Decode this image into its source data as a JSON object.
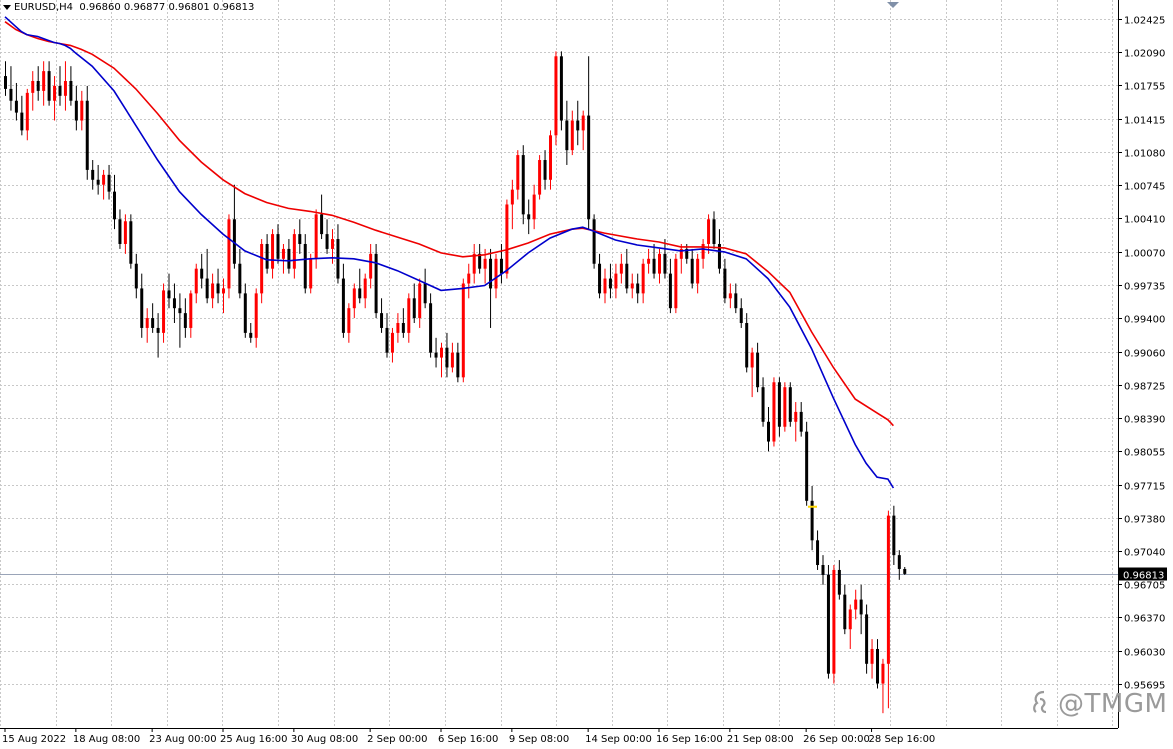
{
  "header": {
    "symbol_tf": "EURUSD,H4",
    "ohlc": "0.96860 0.96877 0.96801 0.96813"
  },
  "watermark": "@TMGM",
  "colors": {
    "bull": "#ff0000",
    "bear": "#000000",
    "ma_fast": "#0000cc",
    "ma_slow": "#ee0000",
    "grid": "#c8c8c8",
    "price_line": "#9aa4b8",
    "marker": "#ffd700"
  },
  "chart_data": {
    "type": "candlestick",
    "symbol": "EURUSD",
    "timeframe": "H4",
    "current_price": 0.96813,
    "current_price_label": "0.96813",
    "ylim": [
      0.9525,
      1.0262
    ],
    "y_ticks": [
      1.02425,
      1.0209,
      1.01755,
      1.01415,
      1.0108,
      1.00745,
      1.0041,
      1.0007,
      0.99735,
      0.994,
      0.9906,
      0.98725,
      0.9839,
      0.98055,
      0.97715,
      0.9738,
      0.9704,
      0.96705,
      0.9637,
      0.9603,
      0.95695
    ],
    "y_tick_labels": [
      "1.02425",
      "1.02090",
      "1.01755",
      "1.01415",
      "1.01080",
      "1.00745",
      "1.00410",
      "1.00070",
      "0.99735",
      "0.99400",
      "0.99060",
      "0.98725",
      "0.98390",
      "0.98055",
      "0.97715",
      "0.97380",
      "0.97040",
      "0.96705",
      "0.96370",
      "0.96030",
      "0.95695"
    ],
    "x_labels": [
      "15 Aug 2022",
      "18 Aug 08:00",
      "23 Aug 00:00",
      "25 Aug 16:00",
      "30 Aug 08:00",
      "2 Sep 00:00",
      "6 Sep 16:00",
      "9 Sep 08:00",
      "14 Sep 00:00",
      "16 Sep 16:00",
      "21 Sep 08:00",
      "26 Sep 00:00",
      "28 Sep 16:00"
    ],
    "marker_price": 0.9749,
    "candles": [
      [
        1.0185,
        1.02,
        1.0165,
        1.0172
      ],
      [
        1.0172,
        1.0195,
        1.015,
        1.016
      ],
      [
        1.016,
        1.0178,
        1.014,
        1.0148
      ],
      [
        1.0148,
        1.0165,
        1.0125,
        1.013
      ],
      [
        1.013,
        1.0172,
        1.012,
        1.0168
      ],
      [
        1.0168,
        1.019,
        1.015,
        1.018
      ],
      [
        1.018,
        1.0195,
        1.016,
        1.017
      ],
      [
        1.017,
        1.02,
        1.0155,
        1.019
      ],
      [
        1.019,
        1.02,
        1.0155,
        1.016
      ],
      [
        1.016,
        1.0185,
        1.014,
        1.0175
      ],
      [
        1.0175,
        1.0195,
        1.0155,
        1.0165
      ],
      [
        1.0165,
        1.02,
        1.015,
        1.018
      ],
      [
        1.018,
        1.0195,
        1.0155,
        1.016
      ],
      [
        1.016,
        1.0175,
        1.013,
        1.014
      ],
      [
        1.014,
        1.017,
        1.013,
        1.016
      ],
      [
        1.016,
        1.0175,
        1.008,
        1.009
      ],
      [
        1.009,
        1.01,
        1.007,
        1.008
      ],
      [
        1.008,
        1.0095,
        1.0065,
        1.0075
      ],
      [
        1.0075,
        1.009,
        1.006,
        1.0085
      ],
      [
        1.0085,
        1.0095,
        1.006,
        1.0068
      ],
      [
        1.0068,
        1.0085,
        1.003,
        1.004
      ],
      [
        1.004,
        1.005,
        1.001,
        1.0015
      ],
      [
        1.0015,
        1.0045,
        1.0005,
        1.0038
      ],
      [
        1.0038,
        1.0045,
        0.999,
        0.9995
      ],
      [
        0.9995,
        1.0005,
        0.996,
        0.997
      ],
      [
        0.997,
        0.9985,
        0.992,
        0.993
      ],
      [
        0.993,
        0.995,
        0.9915,
        0.994
      ],
      [
        0.994,
        0.9955,
        0.9925,
        0.993
      ],
      [
        0.993,
        0.9945,
        0.99,
        0.9925
      ],
      [
        0.9925,
        0.9975,
        0.9915,
        0.9968
      ],
      [
        0.9968,
        0.9985,
        0.995,
        0.996
      ],
      [
        0.996,
        0.9975,
        0.9935,
        0.995
      ],
      [
        0.995,
        0.9965,
        0.991,
        0.9945
      ],
      [
        0.9945,
        0.996,
        0.992,
        0.993
      ],
      [
        0.993,
        0.9968,
        0.992,
        0.9965
      ],
      [
        0.9965,
        0.9995,
        0.9955,
        0.999
      ],
      [
        0.999,
        1.0005,
        0.997,
        0.998
      ],
      [
        0.998,
        1.001,
        0.9955,
        0.996
      ],
      [
        0.996,
        0.9985,
        0.995,
        0.9975
      ],
      [
        0.9975,
        0.999,
        0.9955,
        0.9965
      ],
      [
        0.9965,
        0.998,
        0.9945,
        0.997
      ],
      [
        0.997,
        1.0045,
        0.996,
        1.004
      ],
      [
        1.004,
        1.0075,
        0.999,
        0.9995
      ],
      [
        0.9995,
        1.001,
        0.996,
        0.9965
      ],
      [
        0.9965,
        0.9975,
        0.992,
        0.9925
      ],
      [
        0.9925,
        0.9935,
        0.9915,
        0.992
      ],
      [
        0.992,
        0.997,
        0.991,
        0.9965
      ],
      [
        0.9965,
        1.002,
        0.9955,
        1.0015
      ],
      [
        1.0015,
        1.0025,
        0.9985,
        0.999
      ],
      [
        0.999,
        1.003,
        0.998,
        1.0025
      ],
      [
        1.0025,
        1.0035,
        0.9995,
        1.0
      ],
      [
        1.0,
        1.0015,
        0.9985,
        1.001
      ],
      [
        1.001,
        1.002,
        0.9985,
        0.999
      ],
      [
        0.999,
        1.003,
        0.998,
        1.0025
      ],
      [
        1.0025,
        1.004,
        1.0005,
        1.0015
      ],
      [
        1.0015,
        1.0025,
        0.9965,
        0.997
      ],
      [
        0.997,
        1.0005,
        0.9965,
        1.0
      ],
      [
        1.0,
        1.005,
        0.999,
        1.0045
      ],
      [
        1.0045,
        1.0065,
        1.002,
        1.0025
      ],
      [
        1.0025,
        1.004,
        1.0005,
        1.001
      ],
      [
        1.001,
        1.003,
        0.9995,
        1.002
      ],
      [
        1.002,
        1.0035,
        0.9975,
        0.998
      ],
      [
        0.998,
        0.9995,
        0.992,
        0.9925
      ],
      [
        0.9925,
        0.9955,
        0.9915,
        0.995
      ],
      [
        0.995,
        0.9975,
        0.994,
        0.997
      ],
      [
        0.997,
        0.999,
        0.9955,
        0.996
      ],
      [
        0.996,
        0.9985,
        0.995,
        0.998
      ],
      [
        0.998,
        1.0015,
        0.997,
        1.0005
      ],
      [
        1.0005,
        1.0015,
        0.994,
        0.9945
      ],
      [
        0.9945,
        0.996,
        0.9925,
        0.993
      ],
      [
        0.993,
        0.9945,
        0.99,
        0.9905
      ],
      [
        0.9905,
        0.993,
        0.9895,
        0.9925
      ],
      [
        0.9925,
        0.9945,
        0.9915,
        0.9935
      ],
      [
        0.9935,
        0.995,
        0.992,
        0.9925
      ],
      [
        0.9925,
        0.9965,
        0.9915,
        0.996
      ],
      [
        0.996,
        0.9975,
        0.9935,
        0.994
      ],
      [
        0.994,
        0.998,
        0.993,
        0.9975
      ],
      [
        0.9975,
        0.999,
        0.995,
        0.9955
      ],
      [
        0.9955,
        0.9965,
        0.99,
        0.9905
      ],
      [
        0.9905,
        0.992,
        0.989,
        0.99
      ],
      [
        0.99,
        0.9915,
        0.988,
        0.991
      ],
      [
        0.991,
        0.9925,
        0.988,
        0.989
      ],
      [
        0.989,
        0.9915,
        0.9885,
        0.9905
      ],
      [
        0.9905,
        0.9915,
        0.9875,
        0.988
      ],
      [
        0.988,
        0.998,
        0.9875,
        0.9975
      ],
      [
        0.9975,
        0.9995,
        0.996,
        0.9985
      ],
      [
        0.9985,
        1.0015,
        0.9975,
        1.0005
      ],
      [
        1.0005,
        1.0015,
        0.9985,
        0.999
      ],
      [
        0.999,
        1.001,
        0.9975,
        1.0
      ],
      [
        1.0,
        1.001,
        0.993,
        0.997
      ],
      [
        0.997,
        1.0005,
        0.996,
        1.0
      ],
      [
        1.0,
        1.0015,
        0.9975,
        0.9985
      ],
      [
        0.9985,
        1.006,
        0.998,
        1.0055
      ],
      [
        1.0055,
        1.008,
        1.003,
        1.007
      ],
      [
        1.007,
        1.011,
        1.006,
        1.0105
      ],
      [
        1.0105,
        1.0115,
        1.0035,
        1.0045
      ],
      [
        1.0045,
        1.006,
        1.0025,
        1.004
      ],
      [
        1.004,
        1.0075,
        1.003,
        1.0065
      ],
      [
        1.0065,
        1.0105,
        1.006,
        1.01
      ],
      [
        1.01,
        1.011,
        1.007,
        1.008
      ],
      [
        1.008,
        1.013,
        1.007,
        1.0125
      ],
      [
        1.0125,
        1.021,
        1.0115,
        1.0205
      ],
      [
        1.0205,
        1.021,
        1.013,
        1.014
      ],
      [
        1.014,
        1.016,
        1.0095,
        1.011
      ],
      [
        1.011,
        1.015,
        1.0105,
        1.014
      ],
      [
        1.014,
        1.016,
        1.0115,
        1.013
      ],
      [
        1.013,
        1.015,
        1.011,
        1.0145
      ],
      [
        1.0145,
        1.0205,
        1.003,
        1.004
      ],
      [
        1.004,
        1.0045,
        0.999,
        0.9995
      ],
      [
        0.9995,
        1.0005,
        0.996,
        0.9965
      ],
      [
        0.9965,
        0.999,
        0.9955,
        0.998
      ],
      [
        0.998,
        0.9995,
        0.996,
        0.997
      ],
      [
        0.997,
        0.9995,
        0.996,
        0.9985
      ],
      [
        0.9985,
        1.0005,
        0.9975,
        0.9995
      ],
      [
        0.9995,
        1.001,
        0.9965,
        0.997
      ],
      [
        0.997,
        0.9985,
        0.996,
        0.9975
      ],
      [
        0.9975,
        0.9985,
        0.9955,
        0.9965
      ],
      [
        0.9965,
        1.0,
        0.9955,
        0.9995
      ],
      [
        0.9995,
        1.001,
        0.9985,
        1.0
      ],
      [
        1.0,
        1.0015,
        0.998,
        0.9985
      ],
      [
        0.9985,
        1.001,
        0.9975,
        1.0005
      ],
      [
        1.0005,
        1.002,
        0.998,
        0.9985
      ],
      [
        0.9985,
        1.0,
        0.9945,
        0.995
      ],
      [
        0.995,
        1.0005,
        0.9945,
        1.0
      ],
      [
        1.0,
        1.0015,
        0.9985,
        1.001
      ],
      [
        1.001,
        1.0015,
        0.9995,
        1.0
      ],
      [
        1.0,
        1.001,
        0.997,
        0.9975
      ],
      [
        0.9975,
        1.0005,
        0.9965,
        1.0
      ],
      [
        1.0,
        1.002,
        0.999,
        1.0015
      ],
      [
        1.0015,
        1.0045,
        1.0005,
        1.004
      ],
      [
        1.004,
        1.0048,
        1.001,
        1.0015
      ],
      [
        1.0015,
        1.003,
        0.9985,
        0.999
      ],
      [
        0.999,
        1.0,
        0.9955,
        0.996
      ],
      [
        0.996,
        0.9975,
        0.995,
        0.9965
      ],
      [
        0.9965,
        0.9975,
        0.9945,
        0.995
      ],
      [
        0.995,
        0.996,
        0.993,
        0.9935
      ],
      [
        0.9935,
        0.9945,
        0.9885,
        0.989
      ],
      [
        0.989,
        0.991,
        0.986,
        0.9905
      ],
      [
        0.9905,
        0.9915,
        0.9865,
        0.987
      ],
      [
        0.987,
        0.988,
        0.983,
        0.9835
      ],
      [
        0.9835,
        0.985,
        0.9805,
        0.9815
      ],
      [
        0.9815,
        0.988,
        0.981,
        0.9875
      ],
      [
        0.9875,
        0.988,
        0.982,
        0.983
      ],
      [
        0.983,
        0.9875,
        0.9825,
        0.987
      ],
      [
        0.987,
        0.9875,
        0.983,
        0.9835
      ],
      [
        0.9835,
        0.9855,
        0.9815,
        0.9845
      ],
      [
        0.9845,
        0.9855,
        0.982,
        0.9825
      ],
      [
        0.9825,
        0.9835,
        0.975,
        0.9755
      ],
      [
        0.9755,
        0.977,
        0.9705,
        0.9715
      ],
      [
        0.9715,
        0.9725,
        0.9685,
        0.969
      ],
      [
        0.969,
        0.97,
        0.967,
        0.968
      ],
      [
        0.968,
        0.969,
        0.9575,
        0.958
      ],
      [
        0.958,
        0.969,
        0.957,
        0.9685
      ],
      [
        0.9685,
        0.9695,
        0.9655,
        0.966
      ],
      [
        0.966,
        0.967,
        0.962,
        0.9625
      ],
      [
        0.9625,
        0.965,
        0.9605,
        0.9645
      ],
      [
        0.9645,
        0.9665,
        0.9635,
        0.9655
      ],
      [
        0.9655,
        0.967,
        0.962,
        0.964
      ],
      [
        0.964,
        0.965,
        0.958,
        0.959
      ],
      [
        0.959,
        0.9615,
        0.9575,
        0.9605
      ],
      [
        0.9605,
        0.9615,
        0.9565,
        0.957
      ],
      [
        0.957,
        0.9595,
        0.954,
        0.959
      ],
      [
        0.959,
        0.9745,
        0.9545,
        0.974
      ],
      [
        0.974,
        0.975,
        0.969,
        0.97
      ],
      [
        0.97,
        0.9705,
        0.9675,
        0.9686
      ],
      [
        0.9686,
        0.9688,
        0.968,
        0.9681
      ]
    ],
    "ma_fast": [
      [
        0,
        1.0245
      ],
      [
        1,
        1.024
      ],
      [
        2,
        1.0235
      ],
      [
        3,
        1.023
      ],
      [
        4,
        1.0227
      ],
      [
        5,
        1.0226
      ],
      [
        6,
        1.0225
      ],
      [
        7,
        1.0223
      ],
      [
        8,
        1.0221
      ],
      [
        9,
        1.0219
      ],
      [
        10,
        1.0218
      ],
      [
        11,
        1.0216
      ],
      [
        12,
        1.0213
      ],
      [
        13,
        1.0208
      ],
      [
        16,
        1.0195
      ],
      [
        20,
        1.017
      ],
      [
        24,
        1.0135
      ],
      [
        28,
        1.01
      ],
      [
        32,
        1.0068
      ],
      [
        36,
        1.0045
      ],
      [
        40,
        1.0025
      ],
      [
        44,
        1.0008
      ],
      [
        48,
        0.9999
      ],
      [
        52,
        0.9998
      ],
      [
        56,
        1.0
      ],
      [
        60,
        1.0001
      ],
      [
        64,
        1.0
      ],
      [
        68,
        0.9996
      ],
      [
        72,
        0.9988
      ],
      [
        76,
        0.9978
      ],
      [
        80,
        0.9968
      ],
      [
        84,
        0.997
      ],
      [
        88,
        0.9973
      ],
      [
        92,
        0.9988
      ],
      [
        96,
        1.0006
      ],
      [
        100,
        1.0021
      ],
      [
        104,
        1.003
      ],
      [
        106,
        1.0032
      ],
      [
        108,
        1.0028
      ],
      [
        112,
        1.0019
      ],
      [
        116,
        1.0014
      ],
      [
        120,
        1.0011
      ],
      [
        124,
        1.0008
      ],
      [
        128,
        1.001
      ],
      [
        132,
        1.0007
      ],
      [
        136,
        1.0
      ],
      [
        140,
        0.998
      ],
      [
        144,
        0.9951
      ],
      [
        148,
        0.9909
      ],
      [
        152,
        0.9859
      ],
      [
        156,
        0.9812
      ],
      [
        158,
        0.9793
      ],
      [
        160,
        0.9779
      ],
      [
        162,
        0.9777
      ],
      [
        163,
        0.9768
      ]
    ],
    "ma_slow": [
      [
        0,
        1.024
      ],
      [
        2,
        1.0232
      ],
      [
        4,
        1.0227
      ],
      [
        6,
        1.0223
      ],
      [
        8,
        1.022
      ],
      [
        10,
        1.0218
      ],
      [
        12,
        1.0216
      ],
      [
        14,
        1.0212
      ],
      [
        16,
        1.0207
      ],
      [
        20,
        1.0193
      ],
      [
        24,
        1.0172
      ],
      [
        28,
        1.0147
      ],
      [
        32,
        1.012
      ],
      [
        36,
        1.0098
      ],
      [
        40,
        1.008
      ],
      [
        44,
        1.0066
      ],
      [
        48,
        1.0057
      ],
      [
        52,
        1.0051
      ],
      [
        56,
        1.0048
      ],
      [
        60,
        1.0044
      ],
      [
        64,
        1.0037
      ],
      [
        68,
        1.0029
      ],
      [
        72,
        1.0022
      ],
      [
        76,
        1.0015
      ],
      [
        80,
        1.0006
      ],
      [
        84,
        1.0002
      ],
      [
        88,
        1.0004
      ],
      [
        92,
        1.0009
      ],
      [
        96,
        1.0016
      ],
      [
        100,
        1.0025
      ],
      [
        104,
        1.003
      ],
      [
        106,
        1.0031
      ],
      [
        110,
        1.0026
      ],
      [
        116,
        1.002
      ],
      [
        120,
        1.0017
      ],
      [
        124,
        1.0012
      ],
      [
        128,
        1.0012
      ],
      [
        132,
        1.0011
      ],
      [
        136,
        1.0005
      ],
      [
        140,
        0.9987
      ],
      [
        144,
        0.9966
      ],
      [
        148,
        0.9926
      ],
      [
        152,
        0.989
      ],
      [
        156,
        0.9858
      ],
      [
        160,
        0.9844
      ],
      [
        162,
        0.9837
      ],
      [
        163,
        0.9831
      ]
    ]
  }
}
